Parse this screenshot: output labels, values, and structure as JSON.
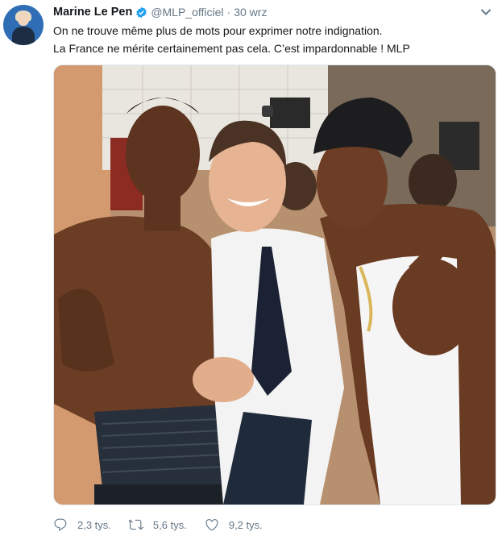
{
  "tweet": {
    "author_name": "Marine Le Pen",
    "handle": "@MLP_officiel",
    "separator": "·",
    "date": "30 wrz",
    "text_line1": "On ne trouve même plus de mots pour exprimer notre indignation.",
    "text_line2": "La France ne mérite certainement pas cela. C’est impardonnable ! MLP",
    "verified": true,
    "accent_color": "#1da1f2"
  },
  "actions": {
    "reply_count": "2,3 tys.",
    "retweet_count": "5,6 tys.",
    "like_count": "9,2 tys."
  },
  "icons": [
    "verified-badge-icon",
    "chevron-down-icon",
    "reply-icon",
    "retweet-icon",
    "like-icon"
  ]
}
